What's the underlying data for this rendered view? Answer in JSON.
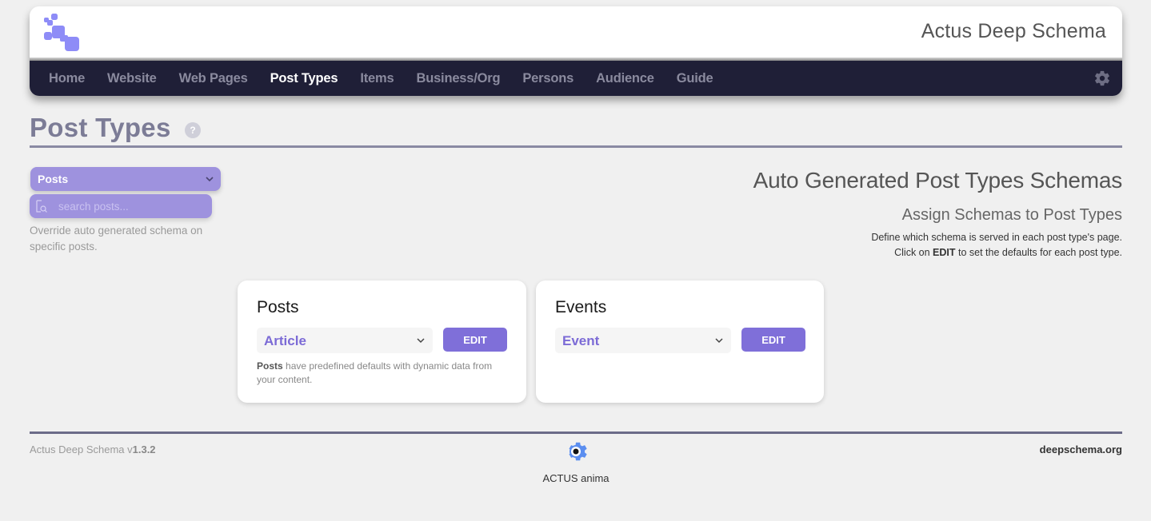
{
  "header": {
    "app_title": "Actus Deep Schema",
    "logo_icon": "actus-blocks-logo",
    "brand_color": "#8e8cf7"
  },
  "nav": {
    "items": [
      {
        "label": "Home",
        "active": false
      },
      {
        "label": "Website",
        "active": false
      },
      {
        "label": "Web Pages",
        "active": false
      },
      {
        "label": "Post Types",
        "active": true
      },
      {
        "label": "Items",
        "active": false
      },
      {
        "label": "Business/Org",
        "active": false
      },
      {
        "label": "Persons",
        "active": false
      },
      {
        "label": "Audience",
        "active": false
      },
      {
        "label": "Guide",
        "active": false
      }
    ],
    "settings_icon": "gear-icon",
    "background": "#1f1f37"
  },
  "page": {
    "title": "Post Types",
    "help_label": "?"
  },
  "sidebar": {
    "post_type_select": {
      "selected": "Posts"
    },
    "search": {
      "placeholder": "search posts...",
      "value": ""
    },
    "override_text": "Override auto generated schema on specific posts.",
    "accent_color": "#9e92de"
  },
  "intro": {
    "heading": "Auto Generated Post Types Schemas",
    "subheading": "Assign Schemas to Post Types",
    "line1": "Define which schema is served in each post type's page.",
    "line2_prefix": "Click on ",
    "line2_bold": "EDIT",
    "line2_suffix": " to set the defaults for each post type."
  },
  "cards": [
    {
      "title": "Posts",
      "schema": "Article",
      "edit_label": "EDIT",
      "note_bold": "Posts",
      "note": " have predefined defaults with dynamic data from your content."
    },
    {
      "title": "Events",
      "schema": "Event",
      "edit_label": "EDIT",
      "note_bold": "",
      "note": ""
    }
  ],
  "footer": {
    "version_prefix": "Actus Deep Schema v",
    "version": "1.3.2",
    "brand": "ACTUS anima",
    "link": "deepschema.org",
    "logo_color": "#5b8ef0"
  }
}
